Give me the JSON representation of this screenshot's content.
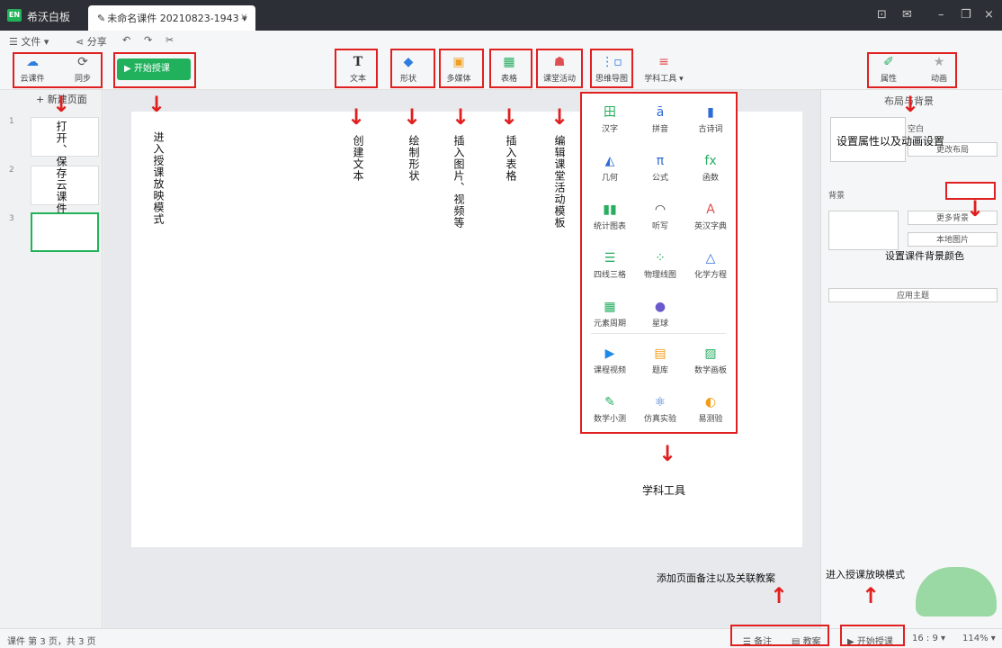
{
  "titlebar": {
    "logo": "EN",
    "app_name": "希沃白板",
    "tab_title": "未命名课件 20210823-1943",
    "tab_dropdown": "▾",
    "tab_close": "×"
  },
  "menubar": {
    "file": "☰ 文件 ▾",
    "share": "分享"
  },
  "toolbar": {
    "cloud": "云课件",
    "sync": "同步",
    "start_teaching": "▶ 开始授课",
    "text": "文本",
    "shape": "形状",
    "media": "多媒体",
    "table": "表格",
    "activity": "课堂活动",
    "mindmap": "思维导图",
    "subject_tools": "学科工具 ▾",
    "attributes": "属性",
    "animation": "动画"
  },
  "left_panel": {
    "new_page": "+ 新建页面",
    "pages": [
      "1",
      "2",
      "3"
    ]
  },
  "right_panel": {
    "tab_title": "布局与背景",
    "blank": "空白",
    "change_layout": "更改布局",
    "background": "背景",
    "more_bg": "更多背景",
    "local_image": "本地图片",
    "apply_theme": "应用主题"
  },
  "subject_panel": {
    "items": [
      {
        "label": "汉字",
        "icon": "田",
        "color": "#27ae60"
      },
      {
        "label": "拼音",
        "icon": "ā",
        "color": "#2e6bd6"
      },
      {
        "label": "古诗词",
        "icon": "▮",
        "color": "#2e6bd6"
      },
      {
        "label": "几何",
        "icon": "◭",
        "color": "#2e6bd6"
      },
      {
        "label": "公式",
        "icon": "π",
        "color": "#2e6bd6"
      },
      {
        "label": "函数",
        "icon": "fx",
        "color": "#27ae60"
      },
      {
        "label": "统计图表",
        "icon": "▮▮",
        "color": "#27ae60"
      },
      {
        "label": "听写",
        "icon": "◠",
        "color": "#333333"
      },
      {
        "label": "英汉字典",
        "icon": "A",
        "color": "#e05050"
      },
      {
        "label": "四线三格",
        "icon": "☰",
        "color": "#27ae60"
      },
      {
        "label": "物理线图",
        "icon": "⁘",
        "color": "#27ae60"
      },
      {
        "label": "化学方程",
        "icon": "△",
        "color": "#2e6bd6"
      },
      {
        "label": "元素周期",
        "icon": "▦",
        "color": "#27ae60"
      },
      {
        "label": "星球",
        "icon": "●",
        "color": "#6a5acd"
      },
      {
        "label": "课程视频",
        "icon": "▶",
        "color": "#1e88e5"
      },
      {
        "label": "题库",
        "icon": "▤",
        "color": "#f39c12"
      },
      {
        "label": "数学画板",
        "icon": "▨",
        "color": "#27ae60"
      },
      {
        "label": "数学小测",
        "icon": "✎",
        "color": "#27ae60"
      },
      {
        "label": "仿真实验",
        "icon": "⚛",
        "color": "#2e6bd6"
      },
      {
        "label": "易测验",
        "icon": "◐",
        "color": "#f39c12"
      }
    ]
  },
  "statusbar": {
    "page_info": "课件 第 3 页，共 3 页",
    "notes": "☰ 备注",
    "lesson_plan": "▤ 教案",
    "start_teaching": "▶ 开始授课",
    "ratio": "16 : 9 ▾",
    "zoom": "114% ▾"
  },
  "annotations": {
    "open_save": "打开、保存云课件",
    "enter_teaching": "进入授课放映模式",
    "create_text": "创建文本",
    "draw_shape": "绘制形状",
    "insert_media": "插入图片、视频等",
    "insert_table": "插入表格",
    "edit_activity": "编辑课堂活动模板",
    "subject_tools": "学科工具",
    "attr_anim": "设置属性以及动画设置",
    "bg_color": "设置课件背景颜色",
    "notes_plan": "添加页面备注以及关联教案",
    "enter_teaching_bottom": "进入授课放映模式"
  }
}
